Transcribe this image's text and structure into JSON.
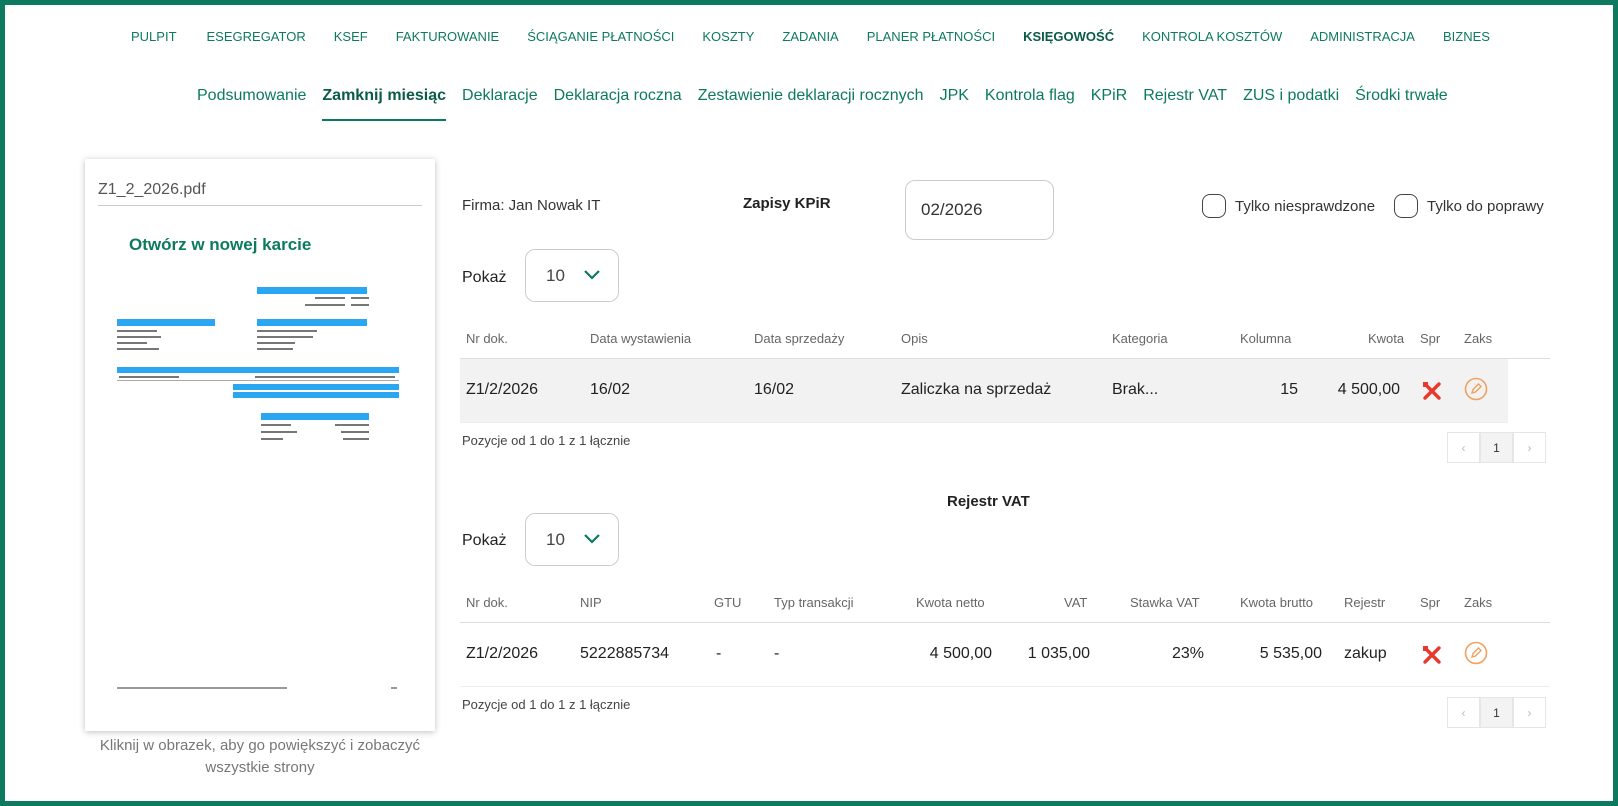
{
  "topnav": [
    {
      "label": "PULPIT",
      "active": false
    },
    {
      "label": "ESEGREGATOR",
      "active": false
    },
    {
      "label": "KSEF",
      "active": false
    },
    {
      "label": "FAKTUROWANIE",
      "active": false
    },
    {
      "label": "ŚCIĄGANIE PŁATNOŚCI",
      "active": false
    },
    {
      "label": "KOSZTY",
      "active": false
    },
    {
      "label": "ZADANIA",
      "active": false
    },
    {
      "label": "PLANER PŁATNOŚCI",
      "active": false
    },
    {
      "label": "KSIĘGOWOŚĆ",
      "active": true
    },
    {
      "label": "KONTROLA KOSZTÓW",
      "active": false
    },
    {
      "label": "ADMINISTRACJA",
      "active": false
    },
    {
      "label": "BIZNES",
      "active": false
    }
  ],
  "subnav": [
    {
      "label": "Podsumowanie",
      "active": false
    },
    {
      "label": "Zamknij miesiąc",
      "active": true
    },
    {
      "label": "Deklaracje",
      "active": false
    },
    {
      "label": "Deklaracja roczna",
      "active": false
    },
    {
      "label": "Zestawienie deklaracji rocznych",
      "active": false
    },
    {
      "label": "JPK",
      "active": false
    },
    {
      "label": "Kontrola flag",
      "active": false
    },
    {
      "label": "KPiR",
      "active": false
    },
    {
      "label": "Rejestr VAT",
      "active": false
    },
    {
      "label": "ZUS i podatki",
      "active": false
    },
    {
      "label": "Środki trwałe",
      "active": false
    }
  ],
  "pdf": {
    "filename": "Z1_2_2026.pdf",
    "open_link": "Otwórz w nowej karcie",
    "caption": "Kliknij w obrazek, aby go powiększyć i zobaczyć wszystkie strony"
  },
  "firma": "Firma: Jan Nowak IT",
  "kpir": {
    "title": "Zapisy KPiR",
    "period": "02/2026",
    "filter_unchecked": "Tylko niesprawdzone",
    "filter_fix": "Tylko do poprawy",
    "show_label": "Pokaż",
    "page_size": "10",
    "columns": [
      "Nr dok.",
      "Data wystawienia",
      "Data sprzedaży",
      "Opis",
      "Kategoria",
      "Kolumna",
      "Kwota",
      "Spr",
      "Zaks"
    ],
    "rows": [
      {
        "nr": "Z1/2/2026",
        "data_wyst": "16/02",
        "data_sprz": "16/02",
        "opis": "Zaliczka na sprzedaż",
        "kategoria": "Brak...",
        "kolumna": "15",
        "kwota": "4 500,00"
      }
    ],
    "pos_info": "Pozycje od 1 do 1 z 1 łącznie",
    "page": "1"
  },
  "vat": {
    "title": "Rejestr VAT",
    "show_label": "Pokaż",
    "page_size": "10",
    "columns": [
      "Nr dok.",
      "NIP",
      "GTU",
      "Typ transakcji",
      "Kwota netto",
      "VAT",
      "Stawka VAT",
      "Kwota brutto",
      "Rejestr",
      "Spr",
      "Zaks"
    ],
    "rows": [
      {
        "nr": "Z1/2/2026",
        "nip": "5222885734",
        "gtu": "-",
        "typ": "-",
        "netto": "4 500,00",
        "vat": "1 035,00",
        "stawka": "23%",
        "brutto": "5 535,00",
        "rejestr": "zakup"
      }
    ],
    "pos_info": "Pozycje od 1 do 1 z 1 łącznie",
    "page": "1"
  },
  "colors": {
    "accent": "#0d7a5f",
    "error": "#e8392c",
    "edit": "#f0a060"
  },
  "icons": {
    "status": "tools-cross-icon",
    "edit": "pencil-circle-icon",
    "dropdown": "chevron-down-icon"
  }
}
